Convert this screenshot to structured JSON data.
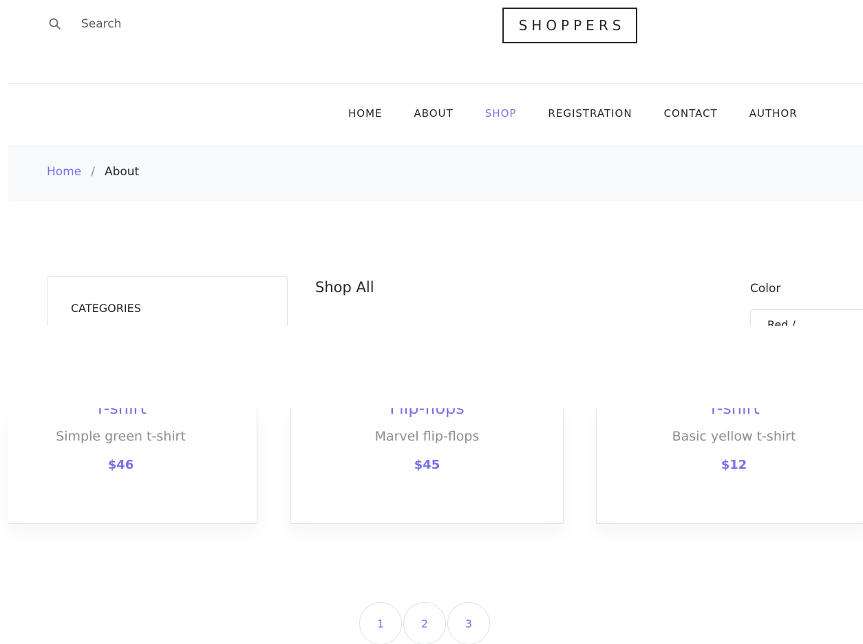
{
  "colors": {
    "accent": "#7971ea",
    "text": "#25262a",
    "muted": "#8c8c91",
    "breadcrumb_bg": "#f8f9fb"
  },
  "header": {
    "search_icon": "search-icon",
    "search_placeholder": "Search",
    "logo": "SHOPPERS"
  },
  "nav": {
    "items": [
      {
        "label": "HOME"
      },
      {
        "label": "ABOUT"
      },
      {
        "label": "SHOP",
        "active": true
      },
      {
        "label": "REGISTRATION"
      },
      {
        "label": "CONTACT"
      },
      {
        "label": "AUTHOR"
      }
    ]
  },
  "breadcrumb": {
    "home": "Home",
    "separator": "/",
    "current": "About"
  },
  "sidebar": {
    "categories_title": "CATEGORIES"
  },
  "shop": {
    "title": "Shop All",
    "color_label": "Color",
    "color_select_partial": "Red / ..."
  },
  "products": [
    {
      "title": "T-shirt",
      "description": "Simple green t-shirt",
      "price": "$46"
    },
    {
      "title": "Flip-flops",
      "description": "Marvel flip-flops",
      "price": "$45"
    },
    {
      "title": "T-shirt",
      "description": "Basic yellow t-shirt",
      "price": "$12"
    }
  ],
  "pagination": {
    "pages": [
      "1",
      "2",
      "3"
    ]
  }
}
